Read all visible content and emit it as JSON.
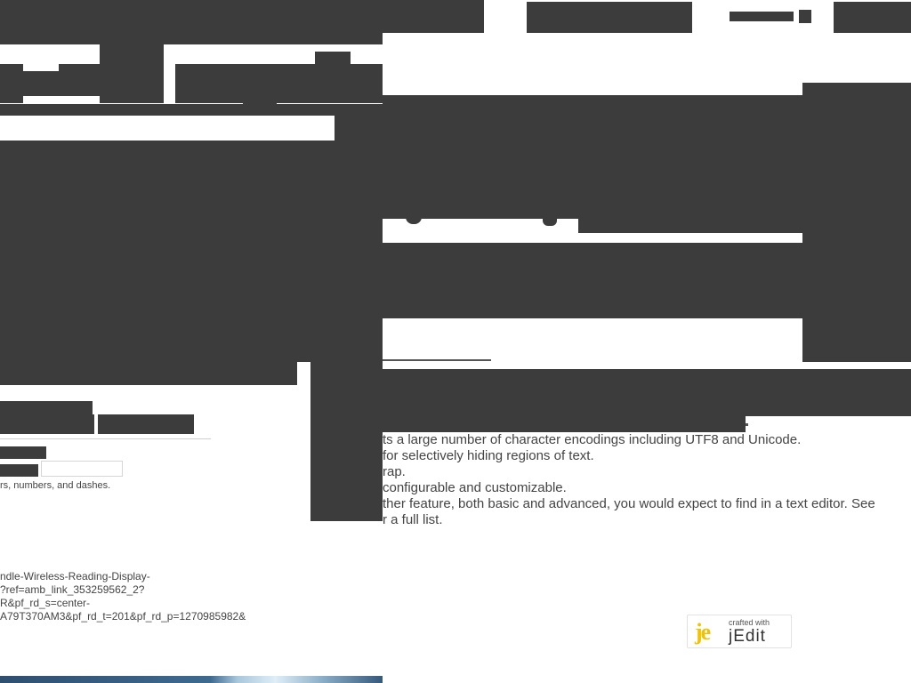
{
  "features": [
    "ts a large number of character encodings including UTF8 and Unicode.",
    " for selectively hiding regions of text.",
    "rap.",
    "configurable and customizable.",
    "ther feature, both basic and advanced, you would expect to find in a text editor. See",
    "r a full list."
  ],
  "form": {
    "hint": "rs, numbers, and dashes."
  },
  "ad_url": "ndle-Wireless-Reading-Display-\n?ref=amb_link_353259562_2?\nR&pf_rd_s=center-\nA79T370AM3&pf_rd_t=201&pf_rd_p=1270985982&",
  "badge": {
    "top_text": "crafted with",
    "brand_text": "jEdit",
    "logo_letters": "je"
  },
  "colors": {
    "occluder": "#3c3c3c",
    "body_text": "#444444",
    "badge_accent": "#f2c200"
  }
}
